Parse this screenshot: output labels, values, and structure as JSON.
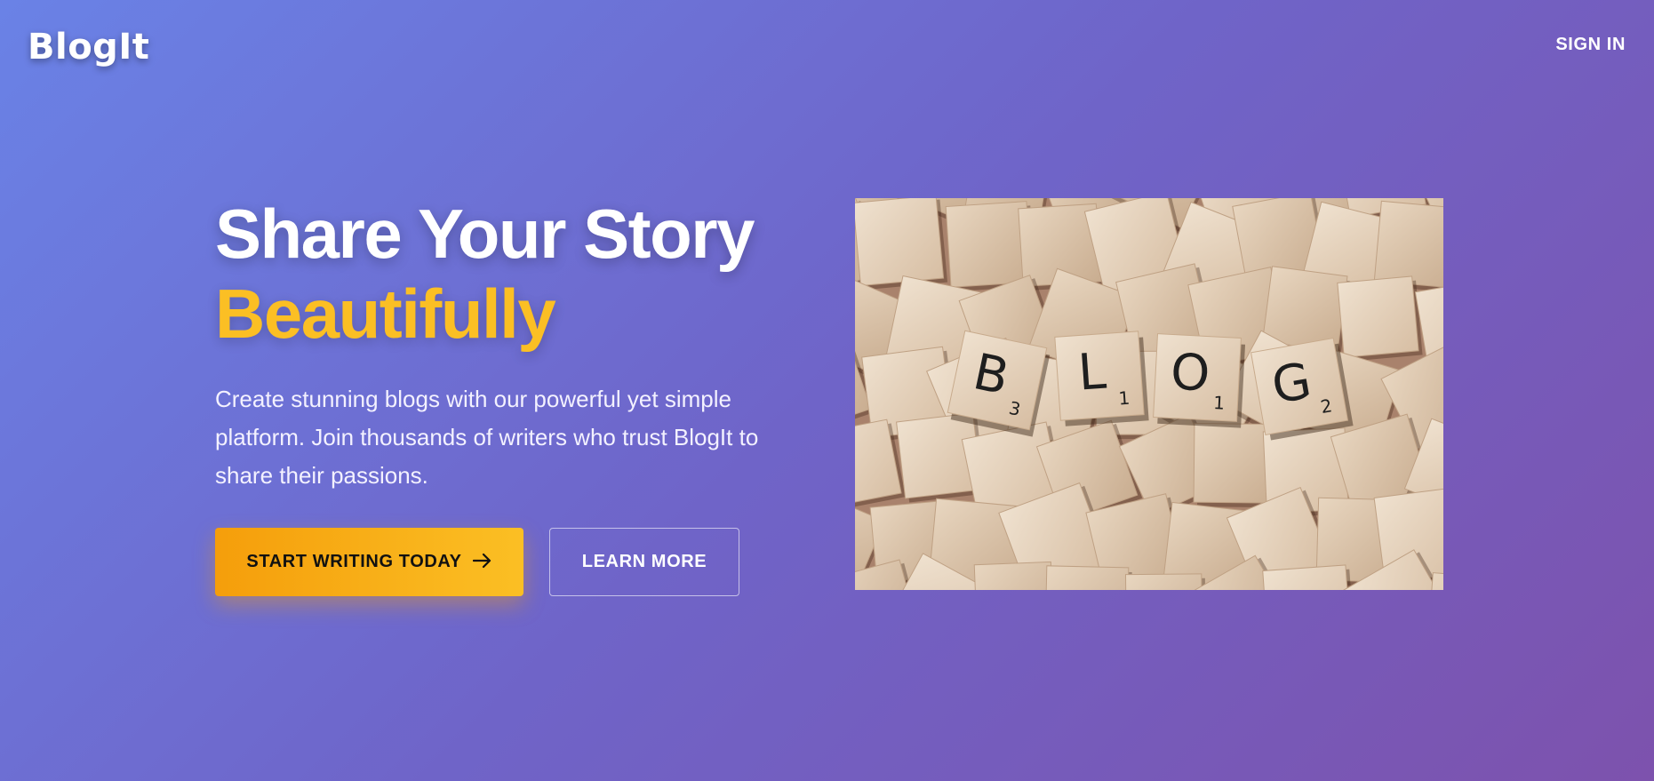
{
  "header": {
    "logo": "BlogIt",
    "sign_in": "SIGN IN"
  },
  "hero": {
    "title_line1": "Share Your Story",
    "title_line2": "Beautifully",
    "description": "Create stunning blogs with our powerful yet simple platform. Join thousands of writers who trust BlogIt to share their passions.",
    "primary_button": "START WRITING TODAY",
    "primary_button_icon": "arrow-right-icon",
    "secondary_button": "LEARN MORE",
    "image": {
      "tiles": [
        {
          "letter": "B",
          "subscript": "3"
        },
        {
          "letter": "L",
          "subscript": "1"
        },
        {
          "letter": "O",
          "subscript": "1"
        },
        {
          "letter": "G",
          "subscript": "2"
        }
      ]
    }
  },
  "colors": {
    "gradient_start": "#6a82e6",
    "gradient_end": "#7d52ad",
    "accent_yellow": "#fbbf24",
    "accent_orange": "#f59e0b"
  }
}
